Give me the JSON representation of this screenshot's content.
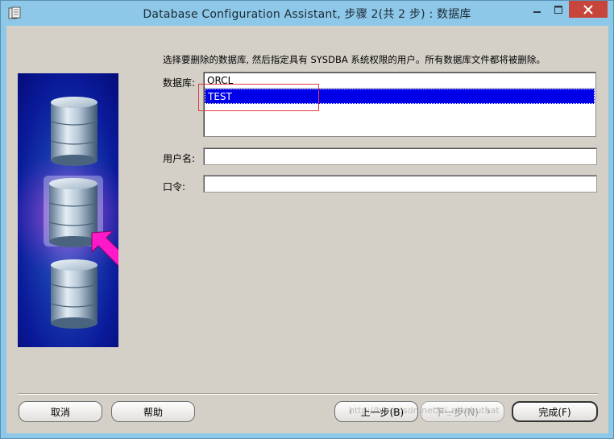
{
  "window": {
    "title": "Database Configuration Assistant, 步骤 2(共 2 步) : 数据库"
  },
  "main": {
    "instruction": "选择要删除的数据库, 然后指定具有 SYSDBA 系统权限的用户。所有数据库文件都将被删除。",
    "database_label": "数据库:",
    "databases": [
      "ORCL",
      "TEST"
    ],
    "selected_database": "TEST",
    "username_label": "用户名:",
    "username_value": "",
    "password_label": "口令:",
    "password_value": ""
  },
  "buttons": {
    "cancel": "取消",
    "help": "帮助",
    "back": "上一步(B)",
    "next": "下一步(N)",
    "finish": "完成(F)"
  },
  "icons": {
    "back_arrow": "‹",
    "next_arrow": "›"
  },
  "watermark": "http://blog.csdn.net/ai_mkchuthat",
  "colors": {
    "titlebar": "#8ec8e8",
    "close_button": "#c7453a",
    "client_bg": "#d4d0c8",
    "selection": "#0000e8",
    "annotation_box": "#e03c3c",
    "pointer_arrow": "#ff19c8"
  }
}
